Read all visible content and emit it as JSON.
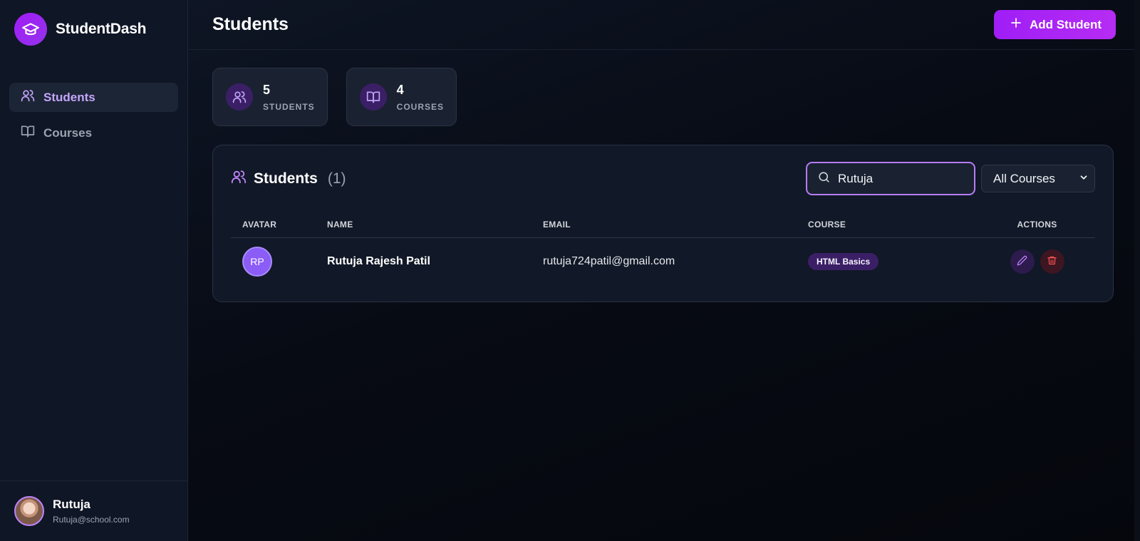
{
  "app": {
    "name": "StudentDash"
  },
  "sidebar": {
    "items": [
      {
        "label": "Students",
        "icon": "users-icon",
        "active": true
      },
      {
        "label": "Courses",
        "icon": "book-icon",
        "active": false
      }
    ],
    "user": {
      "name": "Rutuja",
      "email": "Rutuja@school.com"
    }
  },
  "header": {
    "title": "Students",
    "add_button": "Add Student"
  },
  "stats": [
    {
      "value": "5",
      "label": "STUDENTS",
      "icon": "users-icon"
    },
    {
      "value": "4",
      "label": "COURSES",
      "icon": "book-icon"
    }
  ],
  "panel": {
    "title": "Students",
    "count": "(1)",
    "search": {
      "value": "Rutuja"
    },
    "course_filter": {
      "selected": "All Courses"
    }
  },
  "table": {
    "columns": [
      "AVATAR",
      "NAME",
      "EMAIL",
      "COURSE",
      "ACTIONS"
    ],
    "rows": [
      {
        "initials": "RP",
        "name": "Rutuja Rajesh Patil",
        "email": "rutuja724patil@gmail.com",
        "course": "HTML Basics"
      }
    ]
  },
  "colors": {
    "accent": "#a21cf7",
    "active_nav": "#c4a5fb",
    "background": "#070b14",
    "badge": "#3b1f66",
    "delete": "#dc2626"
  }
}
